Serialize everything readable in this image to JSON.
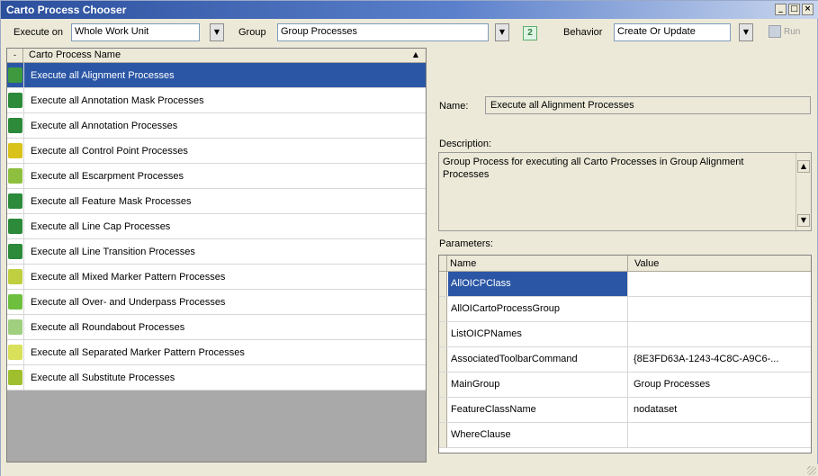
{
  "window": {
    "title": "Carto Process Chooser",
    "controls": [
      "_",
      "□",
      "×"
    ]
  },
  "toolbar": {
    "execute_on_label": "Execute on",
    "execute_on_value": "Whole Work Unit",
    "group_label": "Group",
    "group_value": "Group Processes",
    "group_button_label": "2",
    "behavior_label": "Behavior",
    "behavior_value": "Create Or Update",
    "run_label": "Run"
  },
  "list": {
    "header": "Carto Process Name",
    "items": [
      {
        "label": "Execute all Alignment Processes",
        "icon": "alignment-icon",
        "color": "#3f9a3f",
        "selected": true
      },
      {
        "label": "Execute all Annotation Mask Processes",
        "icon": "annotation-mask-icon",
        "color": "#2c8a3a",
        "selected": false
      },
      {
        "label": "Execute all Annotation Processes",
        "icon": "annotation-icon",
        "color": "#2c8a3a",
        "selected": false
      },
      {
        "label": "Execute all Control Point Processes",
        "icon": "control-point-icon",
        "color": "#d9c21a",
        "selected": false
      },
      {
        "label": "Execute all Escarpment Processes",
        "icon": "escarpment-icon",
        "color": "#8fbf3f",
        "selected": false
      },
      {
        "label": "Execute all Feature Mask Processes",
        "icon": "feature-mask-icon",
        "color": "#2c8a3a",
        "selected": false
      },
      {
        "label": "Execute all Line Cap Processes",
        "icon": "line-cap-icon",
        "color": "#2c8a3a",
        "selected": false
      },
      {
        "label": "Execute all Line Transition Processes",
        "icon": "line-transition-icon",
        "color": "#2c8a3a",
        "selected": false
      },
      {
        "label": "Execute all Mixed Marker Pattern Processes",
        "icon": "mixed-marker-icon",
        "color": "#bfcf3f",
        "selected": false
      },
      {
        "label": "Execute all Over- and Underpass Processes",
        "icon": "overpass-icon",
        "color": "#6fbf3f",
        "selected": false
      },
      {
        "label": "Execute all Roundabout Processes",
        "icon": "roundabout-icon",
        "color": "#9fcf7f",
        "selected": false
      },
      {
        "label": "Execute all Separated Marker Pattern Processes",
        "icon": "separated-marker-icon",
        "color": "#d9e05a",
        "selected": false
      },
      {
        "label": "Execute all Substitute Processes",
        "icon": "substitute-icon",
        "color": "#9fbf2f",
        "selected": false
      }
    ]
  },
  "details": {
    "name_label": "Name:",
    "name_value": "Execute all Alignment Processes",
    "description_label": "Description:",
    "description_value": "Group Process for executing all Carto Processes in Group Alignment Processes",
    "parameters_label": "Parameters:",
    "grid_headers": {
      "name": "Name",
      "value": "Value"
    },
    "parameters": [
      {
        "name": "AllOICPClass",
        "value": "",
        "selected": true
      },
      {
        "name": "AllOICartoProcessGroup",
        "value": "",
        "selected": false
      },
      {
        "name": "ListOICPNames",
        "value": "",
        "selected": false
      },
      {
        "name": "AssociatedToolbarCommand",
        "value": "{8E3FD63A-1243-4C8C-A9C6-...",
        "selected": false
      },
      {
        "name": "MainGroup",
        "value": "Group Processes",
        "selected": false
      },
      {
        "name": "FeatureClassName",
        "value": "nodataset",
        "selected": false
      },
      {
        "name": "WhereClause",
        "value": "",
        "selected": false
      }
    ]
  }
}
